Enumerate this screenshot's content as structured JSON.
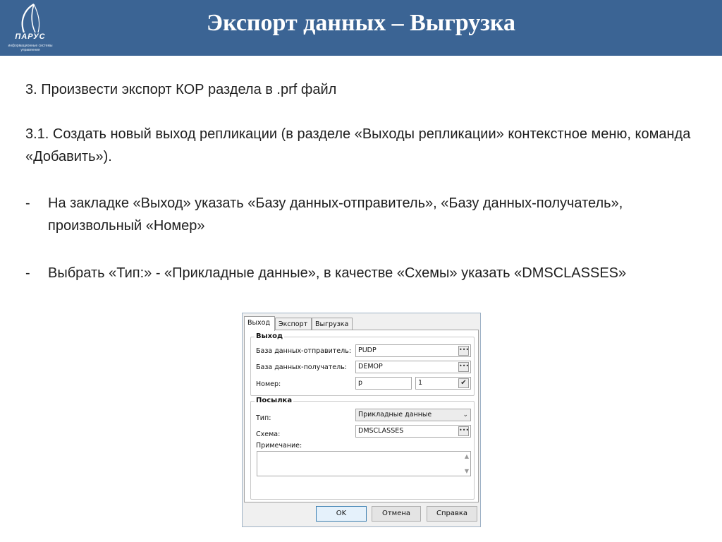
{
  "header": {
    "title": "Экспорт данных – Выгрузка",
    "logo_text": "ПАРУС",
    "logo_sub": "информационные системы управления",
    "bg_color": "#3b6494"
  },
  "content": {
    "step3": "3. Произвести экспорт КОР раздела в .prf файл",
    "step3_1": "3.1. Создать новый выход репликации (в разделе «Выходы репликации» контекстное меню, команда «Добавить»).",
    "bullets": [
      {
        "dash": "-",
        "text": "На закладке «Выход» указать «Базу данных-отправитель», «Базу данных-получатель», произвольный «Номер»"
      },
      {
        "dash": "-",
        "text": "Выбрать «Тип:» - «Прикладные данные», в качестве «Схемы» указать «DMSCLASSES»"
      }
    ]
  },
  "dialog": {
    "tabs": [
      "Выход",
      "Экспорт",
      "Выгрузка"
    ],
    "group_output": {
      "title": "Выход",
      "sender_label": "База данных-отправитель:",
      "sender_value": "PUDP",
      "receiver_label": "База данных-получатель:",
      "receiver_value": "DEMOP",
      "number_label": "Номер:",
      "number_prefix": "p",
      "number_value": "1"
    },
    "group_package": {
      "title": "Посылка",
      "type_label": "Тип:",
      "type_value": "Прикладные данные",
      "schema_label": "Схема:",
      "schema_value": "DMSCLASSES",
      "note_label": "Примечание:"
    },
    "dots_glyph": "•••",
    "check_glyph": "✔",
    "arrow_glyph": "⌄",
    "buttons": {
      "ok": "OK",
      "cancel": "Отмена",
      "help": "Справка"
    }
  }
}
